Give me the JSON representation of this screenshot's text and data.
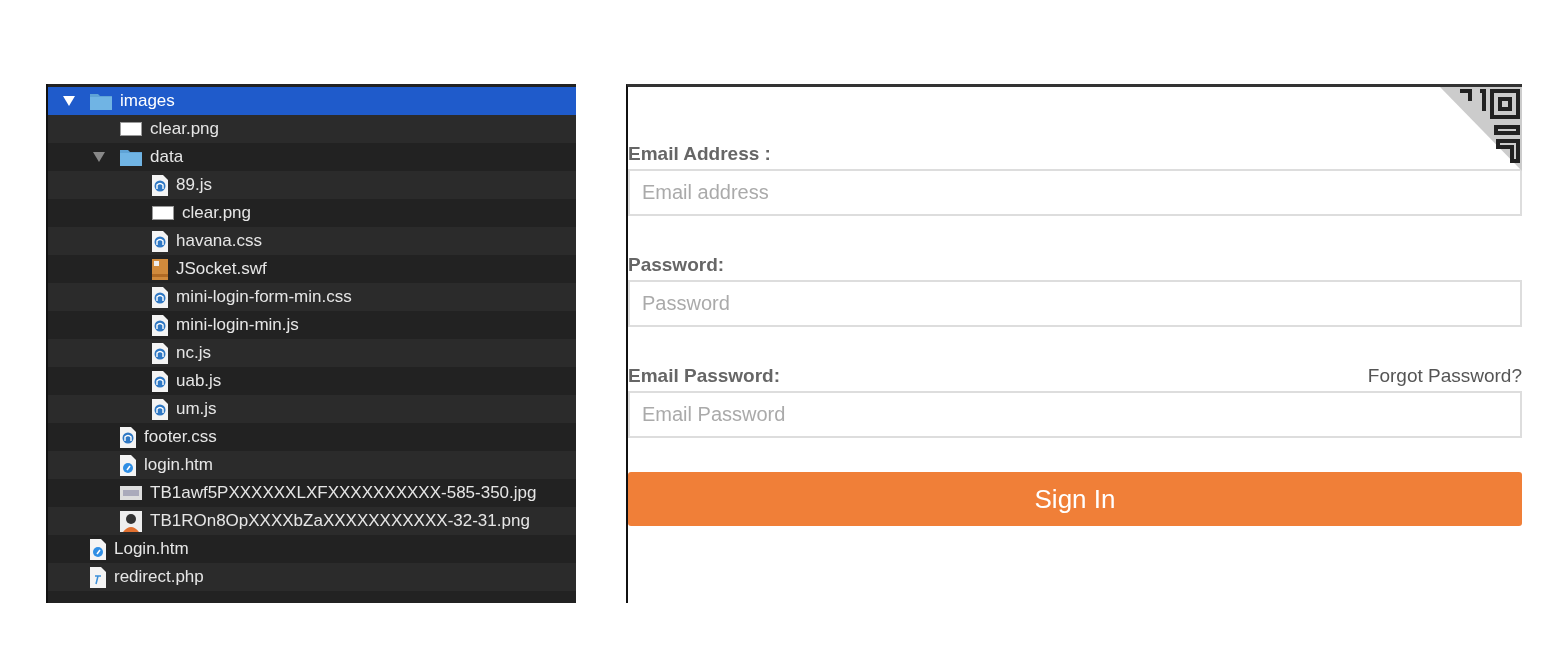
{
  "file_tree": [
    {
      "name": "images",
      "kind": "folder",
      "expanded": true,
      "selected": true,
      "children": [
        {
          "name": "clear.png",
          "kind": "blank",
          "selected": false
        },
        {
          "name": "data",
          "kind": "folder",
          "expanded": true,
          "selected": false,
          "children": [
            {
              "name": "89.js",
              "kind": "code",
              "selected": false
            },
            {
              "name": "clear.png",
              "kind": "blank",
              "selected": false
            },
            {
              "name": "havana.css",
              "kind": "code",
              "selected": false
            },
            {
              "name": "JSocket.swf",
              "kind": "archive",
              "selected": false
            },
            {
              "name": "mini-login-form-min.css",
              "kind": "code",
              "selected": false
            },
            {
              "name": "mini-login-min.js",
              "kind": "code",
              "selected": false
            },
            {
              "name": "nc.js",
              "kind": "code",
              "selected": false
            },
            {
              "name": "uab.js",
              "kind": "code",
              "selected": false
            },
            {
              "name": "um.js",
              "kind": "code",
              "selected": false
            }
          ]
        },
        {
          "name": "footer.css",
          "kind": "code",
          "selected": false
        },
        {
          "name": "login.htm",
          "kind": "web",
          "selected": false
        },
        {
          "name": "TB1awf5PXXXXXXLXFXXXXXXXXXX-585-350.jpg",
          "kind": "keyboard",
          "selected": false
        },
        {
          "name": "TB1ROn8OpXXXXbZaXXXXXXXXXXX-32-31.png",
          "kind": "person",
          "selected": false
        }
      ]
    },
    {
      "name": "Login.htm",
      "kind": "web",
      "selected": false
    },
    {
      "name": "redirect.php",
      "kind": "script",
      "selected": false
    }
  ],
  "login_form": {
    "fields": [
      {
        "label": "Email Address :",
        "placeholder": "Email address"
      },
      {
        "label": "Password:",
        "placeholder": "Password"
      },
      {
        "label": "Email Password:",
        "placeholder": "Email Password",
        "link": "Forgot Password?"
      }
    ],
    "submit": "Sign In"
  }
}
